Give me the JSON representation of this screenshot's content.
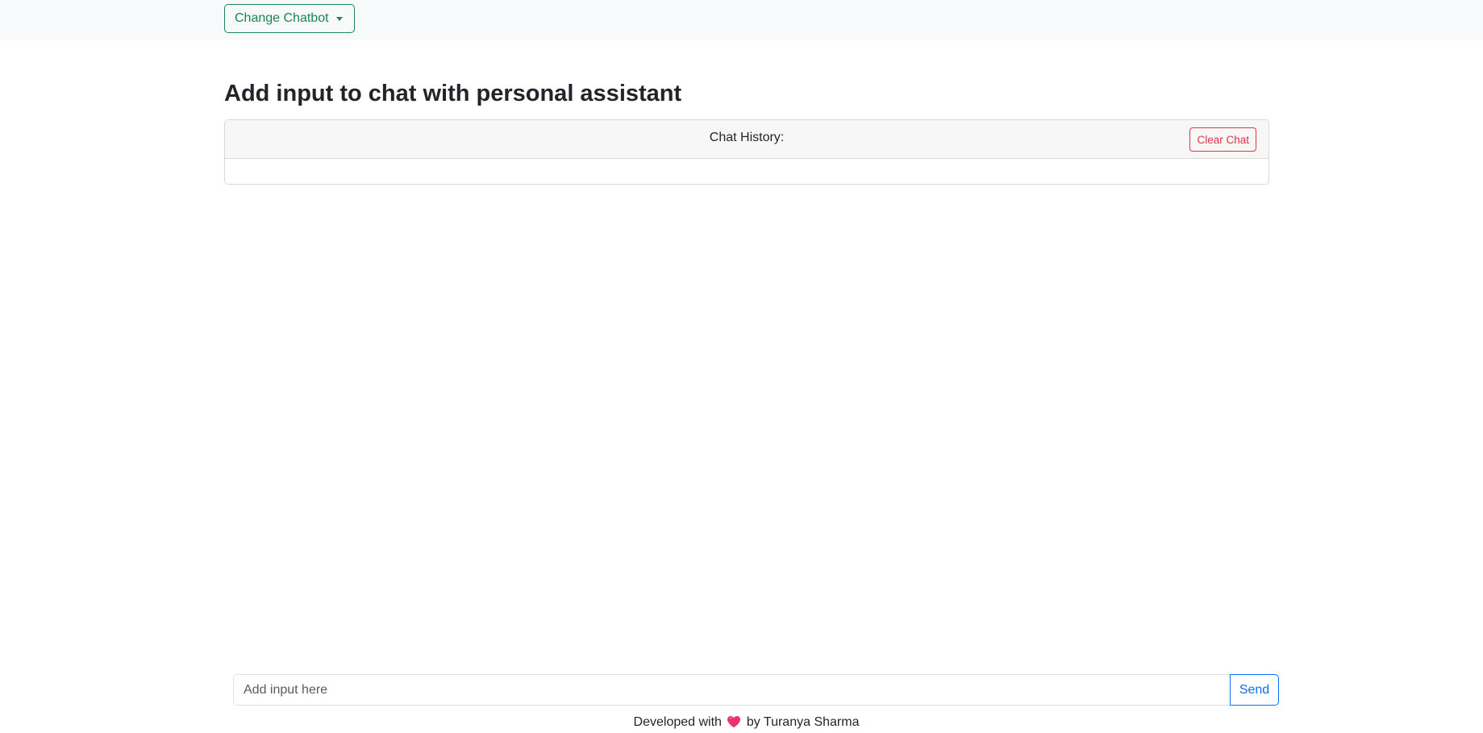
{
  "navbar": {
    "dropdown_label": "Change Chatbot",
    "dropdown_icon": "chevron-down-icon"
  },
  "main": {
    "title": "Add input to chat with personal assistant",
    "chat_card": {
      "header_title": "Chat History:",
      "clear_button_label": "Clear Chat",
      "messages": []
    }
  },
  "composer": {
    "input_placeholder": "Add input here",
    "input_value": "",
    "send_button_label": "Send"
  },
  "footer": {
    "prefix": "Developed with",
    "icon": "heart-icon",
    "suffix": "by Turanya Sharma"
  },
  "colors": {
    "success": "#198754",
    "danger": "#dc3545",
    "primary": "#0d6efd",
    "heart": "#e8336e",
    "navbar_bg": "#f8f9fa"
  }
}
